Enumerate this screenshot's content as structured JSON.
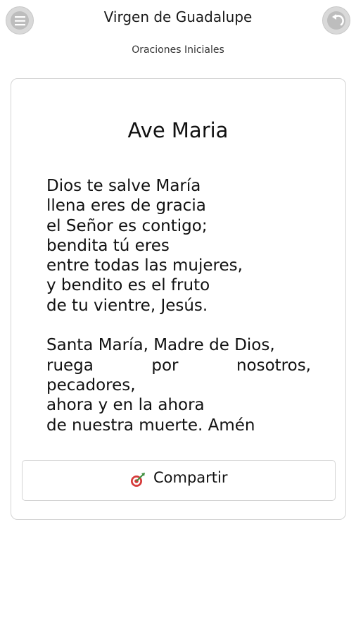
{
  "header": {
    "title": "Virgen de Guadalupe",
    "subtitle": "Oraciones Iniciales",
    "menu_icon": "hamburger-menu-icon",
    "back_icon": "back-arrow-icon"
  },
  "prayer": {
    "title": "Ave Maria",
    "lines": [
      "Dios te salve María",
      "llena eres de gracia",
      "el Señor es contigo;",
      "bendita tú eres",
      "entre todas las mujeres,",
      "y bendito es el fruto",
      "de tu vientre, Jesús.",
      "",
      "Santa María, Madre de Dios,",
      "ruega por nosotros,",
      "pecadores,",
      "ahora y en la ahora",
      "de nuestra muerte. Amén"
    ]
  },
  "share": {
    "label": "Compartir",
    "icon": "share-target-icon"
  },
  "colors": {
    "button_gray": "#d9d9d9",
    "border": "#d4d4d4",
    "share_icon_red": "#d63a3a",
    "share_icon_green": "#3f8f3f"
  }
}
